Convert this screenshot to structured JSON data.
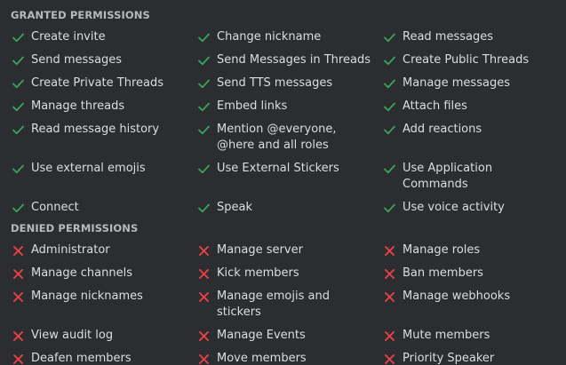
{
  "granted": {
    "title": "GRANTED PERMISSIONS",
    "status_color": "#3ba55d",
    "icon": "check-icon",
    "items": [
      "Create invite",
      "Change nickname",
      "Read messages",
      "Send messages",
      "Send Messages in Threads",
      "Create Public Threads",
      "Create Private Threads",
      "Send TTS messages",
      "Manage messages",
      "Manage threads",
      "Embed links",
      "Attach files",
      "Read message history",
      "Mention @everyone, @here and all roles",
      "Add reactions",
      "Use external emojis",
      "Use External Stickers",
      "Use Application Commands",
      "Connect",
      "Speak",
      "Use voice activity"
    ]
  },
  "denied": {
    "title": "DENIED PERMISSIONS",
    "status_color": "#ed4245",
    "icon": "cross-icon",
    "items": [
      "Administrator",
      "Manage server",
      "Manage roles",
      "Manage channels",
      "Kick members",
      "Ban members",
      "Manage nicknames",
      "Manage emojis and stickers",
      "Manage webhooks",
      "View audit log",
      "Manage Events",
      "Mute members",
      "Deafen members",
      "Move members",
      "Priority Speaker"
    ]
  }
}
